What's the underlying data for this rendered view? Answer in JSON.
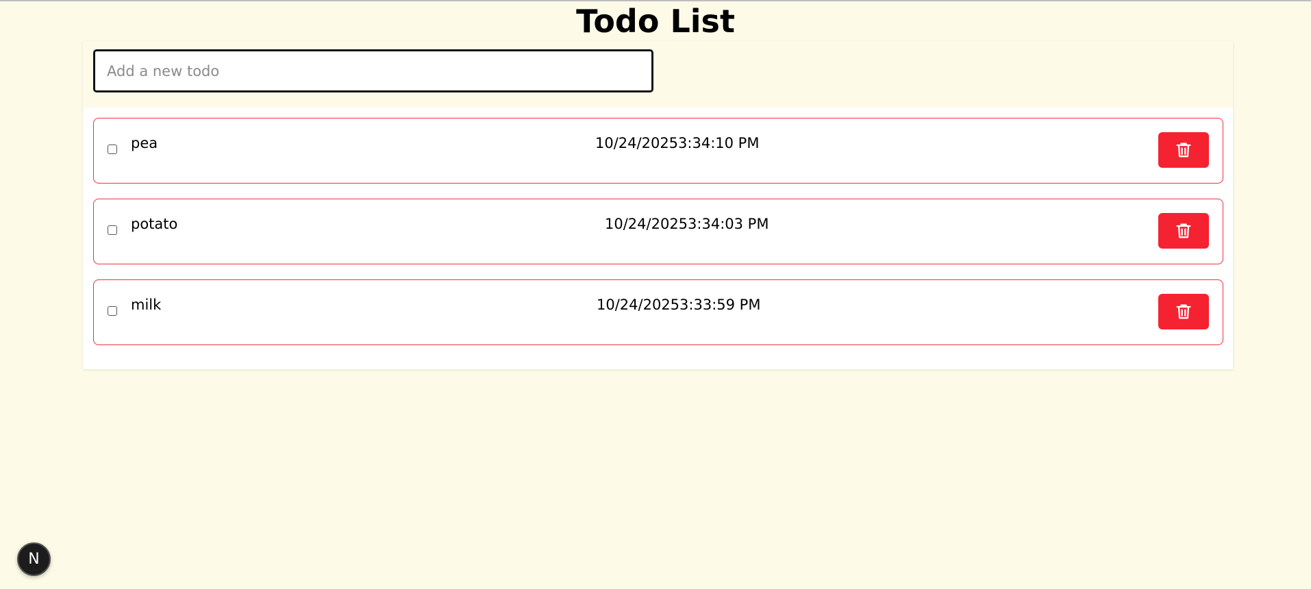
{
  "page": {
    "title": "Todo List"
  },
  "input": {
    "placeholder": "Add a new todo",
    "value": ""
  },
  "todos": [
    {
      "text": "pea",
      "date": "10/24/20253:34:10 PM",
      "completed": false
    },
    {
      "text": "potato",
      "date": "10/24/20253:34:03 PM",
      "completed": false
    },
    {
      "text": "milk",
      "date": "10/24/20253:33:59 PM",
      "completed": false
    }
  ],
  "icons": {
    "delete": "trash-icon",
    "badge": "nextjs-logo-icon"
  },
  "badge": {
    "letter": "N"
  },
  "colors": {
    "background": "#fefae8",
    "accent": "#f52231",
    "item_border": "#f0303e"
  }
}
